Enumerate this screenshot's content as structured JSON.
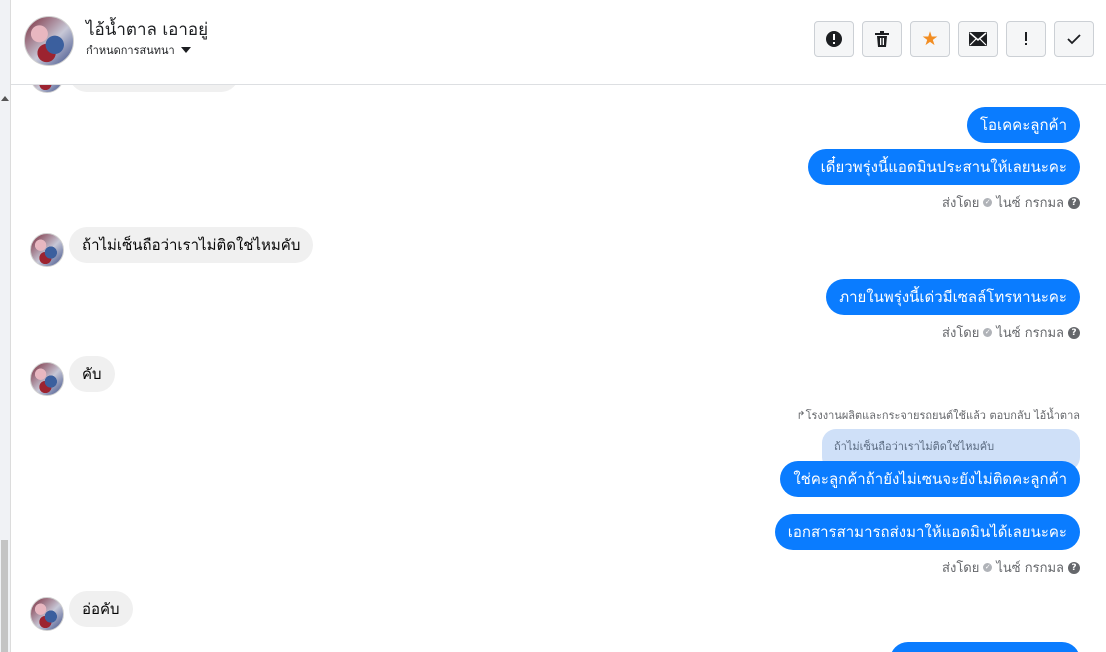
{
  "header": {
    "contact_name": "ไอ้น้ำตาล เอาอยู่",
    "assign_label": "กำหนดการสนทนา"
  },
  "actions": [
    {
      "name": "spam-report",
      "icon": "alert-circle-icon"
    },
    {
      "name": "delete",
      "icon": "trash-icon"
    },
    {
      "name": "star",
      "icon": "star-icon"
    },
    {
      "name": "mark-unread",
      "icon": "envelope-icon"
    },
    {
      "name": "follow-up",
      "icon": "exclamation-icon"
    },
    {
      "name": "done",
      "icon": "check-icon"
    }
  ],
  "messages": {
    "out1": "โอเคคะลูกค้า",
    "out2": "เดี๋ยวพรุ่งนี้แอดมินประสานให้เลยนะคะ",
    "in1": "ถ้าไม่เซ็นถือว่าเราไม่ติดใช่ไหมคับ",
    "out3": "ภายในพรุ่งนี้เด่วมีเซลล์โทรหานะคะ",
    "in2": "คับ",
    "reply_note": "โรงงานผลิตและกระจายรถยนต์ใช้แล้ว ตอบกลับ ไอ้น้ำตาล",
    "quoted": "ถ้าไม่เซ็นถือว่าเราไม่ติดใช่ไหมคับ",
    "out4": "ใช่คะลูกค้าถ้ายังไม่เซนจะยังไม่ติดคะลูกค้า",
    "out5": "เอกสารสามารถส่งมาให้แอดมินได้เลยนะคะ",
    "in3": "อ่อคับ"
  },
  "sent_by": {
    "prefix": "ส่งโดย",
    "agent": "ไนซ์ กรกมล"
  },
  "colors": {
    "outgoing_bubble": "#0a7cff",
    "incoming_bubble": "#f0f0f0",
    "quoted_bubble": "#cfe0f8",
    "star": "#f28d22"
  }
}
